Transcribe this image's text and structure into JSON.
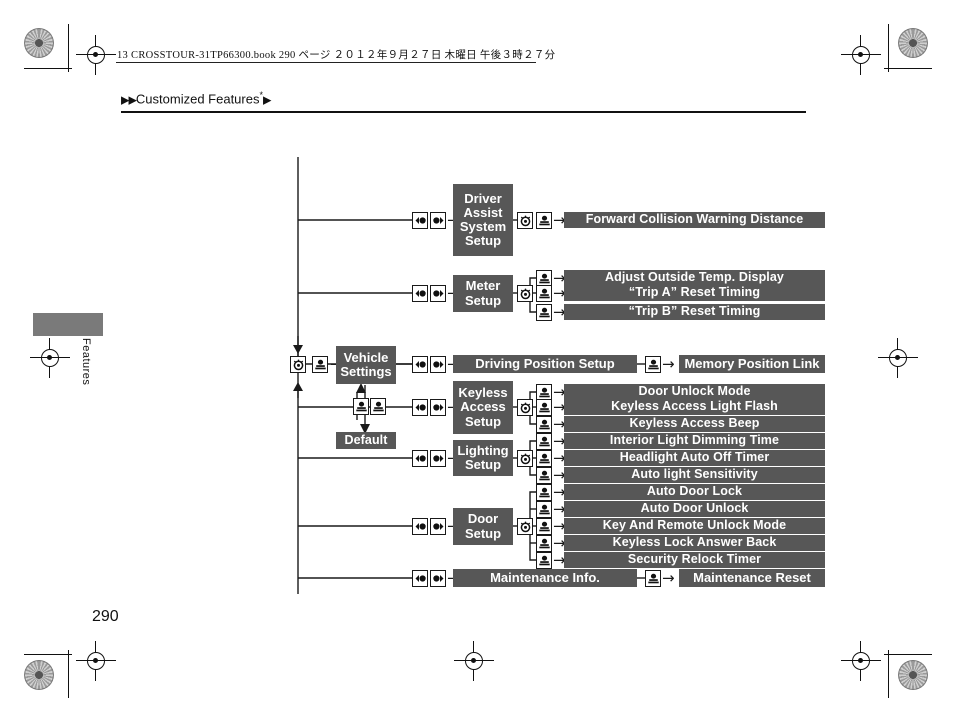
{
  "print_header": {
    "text": "13 CROSSTOUR-31TP66300.book   290 ページ    ２０１２年９月２７日   木曜日   午後３時２７分"
  },
  "breadcrumb": {
    "marker_left": "▶▶",
    "title": "Customized Features",
    "star": "*",
    "marker_right": "▶"
  },
  "side_tab": {
    "label": "Features"
  },
  "page": {
    "number": "290"
  },
  "chart_data": {
    "type": "diagram",
    "title": "Vehicle Settings menu tree",
    "root": {
      "label": "Vehicle Settings",
      "default_label": "Default",
      "enter_icons": [
        "dial-knob-icon",
        "press-button-icon"
      ],
      "default_icons": [
        "press-button-icon",
        "press-button-icon"
      ]
    },
    "branch_icons": [
      "left-select-icon",
      "right-select-icon"
    ],
    "branches": [
      {
        "category": "Driver Assist System Setup",
        "category_lines": [
          "Driver",
          "Assist",
          "System",
          "Setup"
        ],
        "mid_icons": [
          "dial-knob-icon",
          "press-button-icon"
        ],
        "items": [
          "Forward Collision Warning Distance"
        ]
      },
      {
        "category": "Meter Setup",
        "category_lines": [
          "Meter",
          "Setup"
        ],
        "mid_icons": [
          "dial-knob-icon"
        ],
        "items": [
          "Adjust Outside Temp. Display",
          "“Trip A” Reset Timing",
          "“Trip B” Reset Timing"
        ]
      },
      {
        "category": "Driving Position Setup",
        "category_lines": [
          "Driving Position Setup"
        ],
        "mid_icons": [
          "press-button-icon"
        ],
        "items": [
          "Memory Position Link"
        ]
      },
      {
        "category": "Keyless Access Setup",
        "category_lines": [
          "Keyless",
          "Access",
          "Setup"
        ],
        "mid_icons": [
          "dial-knob-icon"
        ],
        "items": [
          "Door Unlock Mode",
          "Keyless Access Light Flash",
          "Keyless Access Beep"
        ]
      },
      {
        "category": "Lighting Setup",
        "category_lines": [
          "Lighting",
          "Setup"
        ],
        "mid_icons": [
          "dial-knob-icon"
        ],
        "items": [
          "Interior Light Dimming Time",
          "Headlight Auto Off Timer",
          "Auto light Sensitivity"
        ]
      },
      {
        "category": "Door Setup",
        "category_lines": [
          "Door",
          "Setup"
        ],
        "mid_icons": [
          "dial-knob-icon"
        ],
        "items": [
          "Auto Door Lock",
          "Auto Door Unlock",
          "Key And Remote Unlock Mode",
          "Keyless Lock Answer Back",
          "Security Relock Timer"
        ]
      },
      {
        "category": "Maintenance Info.",
        "category_lines": [
          "Maintenance Info."
        ],
        "mid_icons": [
          "press-button-icon"
        ],
        "items": [
          "Maintenance Reset"
        ]
      }
    ],
    "colors": {
      "node_fill": "#575757",
      "node_text": "#ffffff",
      "line": "#1a1a1a"
    }
  }
}
